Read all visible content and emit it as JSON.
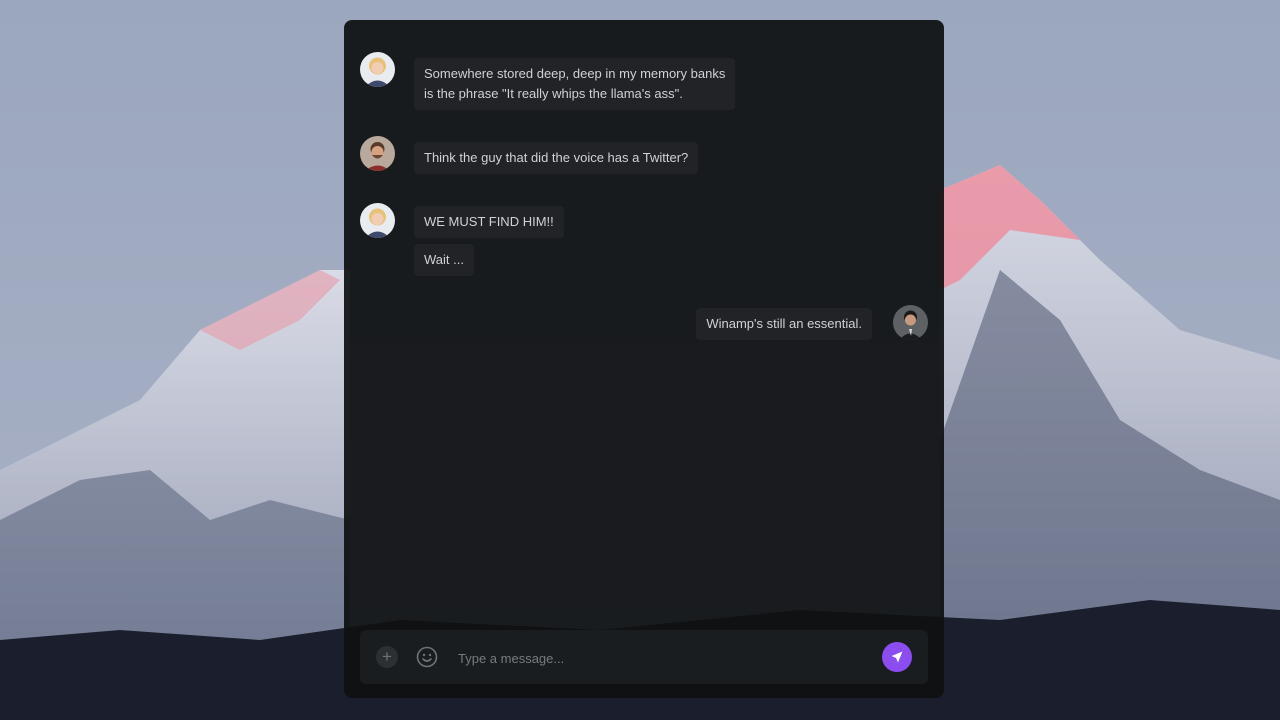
{
  "colors": {
    "accent": "#8b4cf0",
    "panel": "#0e1011",
    "bubble_text": "#cfd2d6"
  },
  "messages": [
    {
      "sender": "woman-blonde",
      "side": "left",
      "lines": [
        "Somewhere stored deep, deep in my memory banks",
        "is the phrase \"It really whips the llama's ass\"."
      ]
    },
    {
      "sender": "man-beard",
      "side": "left",
      "lines": [
        "Think the guy that did the voice has a Twitter?"
      ]
    },
    {
      "sender": "woman-blonde",
      "side": "left",
      "lines": [
        "WE MUST FIND HIM!!"
      ]
    },
    {
      "sender": "woman-blonde",
      "side": "left",
      "lines": [
        "Wait ..."
      ]
    },
    {
      "sender": "self",
      "side": "right",
      "lines": [
        "Winamp's still an essential."
      ]
    }
  ],
  "composer": {
    "add_icon": "plus-icon",
    "add_label": "+",
    "emoji_icon": "smiley-icon",
    "placeholder": "Type a message...",
    "send_icon": "paper-plane-icon"
  }
}
